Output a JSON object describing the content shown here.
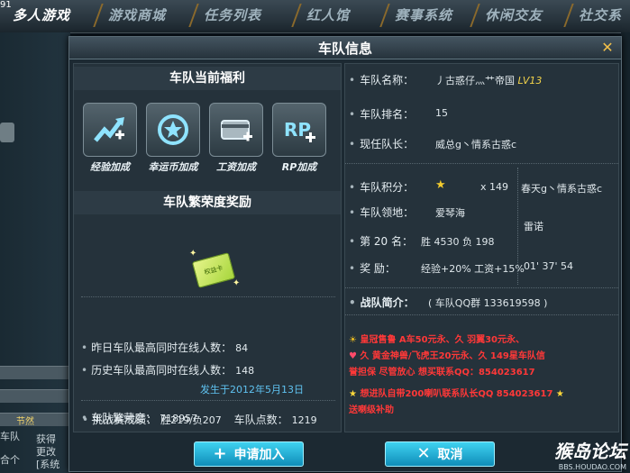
{
  "nav": {
    "tabs": [
      "多人游戏",
      "游戏商城",
      "任务列表",
      "红人馆",
      "赛事系统",
      "休闲交友",
      "社交系"
    ],
    "corner_text": "91"
  },
  "left_strip": {
    "rows": [
      "",
      "",
      "节然"
    ],
    "texts": [
      "车队",
      "获得",
      "更改",
      "[系统",
      "合个"
    ]
  },
  "modal": {
    "title": "车队信息",
    "close_symbol": "✕"
  },
  "benefits": {
    "title": "车队当前福利",
    "items": [
      {
        "label": "经验加成",
        "icon": "exp-boost-icon"
      },
      {
        "label": "幸运币加成",
        "icon": "lucky-coin-icon"
      },
      {
        "label": "工资加成",
        "icon": "salary-card-icon"
      },
      {
        "label": "RP加成",
        "icon": "rp-plus-icon"
      }
    ]
  },
  "prosperity": {
    "title": "车队繁荣度奖励",
    "ticket_text": "权益卡",
    "stats": [
      {
        "label": "昨日车队最高同时在线人数：",
        "value": "84"
      },
      {
        "label": "历史车队最高同时在线人数：",
        "value": "148"
      }
    ],
    "date_note": "发生于2012年5月13日",
    "prosperity_label": "车队繁荣度：",
    "prosperity_value": "718957",
    "challenge_label": "挑战赛成绩：",
    "challenge_value": "胜219/负207",
    "points_label": "车队点数：",
    "points_value": "1219"
  },
  "team": {
    "name_label": "车队名称：",
    "name_value": "丿古惑仔灬艹帝国",
    "level": "LV13",
    "rank_label": "车队排名：",
    "rank_value": "15",
    "captain_label": "现任队长：",
    "captain_value": "威总g丶情系古惑c",
    "score_label": "车队积分：",
    "score_star": "★",
    "score_value": "x 149",
    "territory_label": "车队领地：",
    "territory_value": "爱琴海",
    "record_label": "第 20 名：",
    "record_value": "胜  4530  负 198",
    "reward_label": "奖    励：",
    "reward_value": "经验+20% 工资+15%",
    "side_name1": "春天g丶情系古惑c",
    "side_name2": "雷诺",
    "side_time": "01' 37' 54",
    "intro_label": "战队简介：",
    "intro_qq": "( 车队QQ群      133619598       )"
  },
  "intro_text": {
    "line1": "皇冠售鲁 A车50元永、久 羽翼30元永、",
    "line2": "久 黄金神兽/飞虎王20元永、久 149星车队信",
    "line3": "誉担保 尽管放心      想买联系QQ：854023617",
    "line4": "想进队自带200喇叭联系队长QQ 854023617",
    "line5": "送喇级补助"
  },
  "buttons": {
    "apply_label": "申请加入",
    "apply_icon": "+",
    "cancel_label": "取消",
    "cancel_icon": "✕"
  },
  "watermark": {
    "main": "猴岛论坛",
    "sub": "BBS.HOUDAO.COM"
  }
}
